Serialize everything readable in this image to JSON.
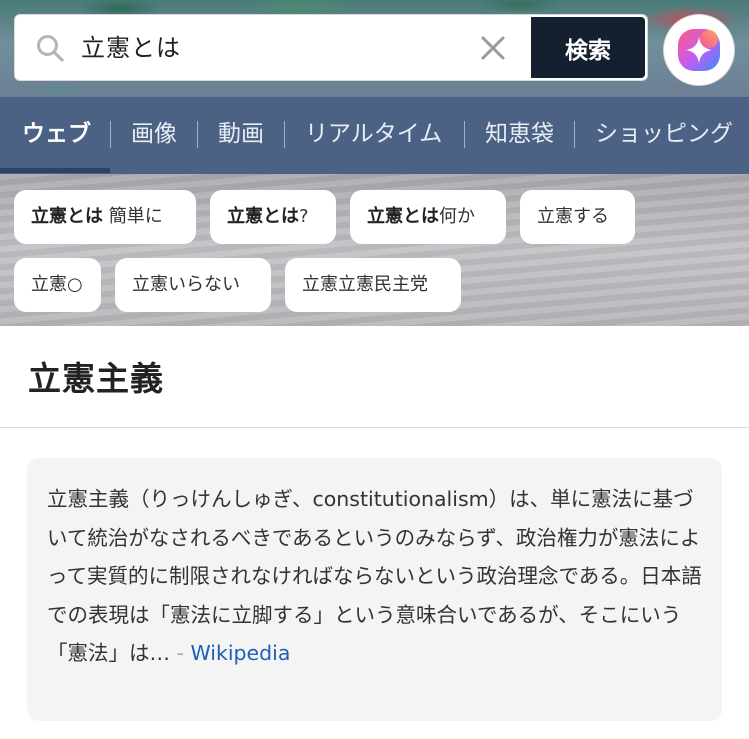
{
  "search": {
    "query": "立憲とは",
    "button_label": "検索"
  },
  "tabs": [
    {
      "label": "ウェブ"
    },
    {
      "label": "画像"
    },
    {
      "label": "動画"
    },
    {
      "label": "リアルタイム"
    },
    {
      "label": "知恵袋"
    },
    {
      "label": "ショッピング"
    }
  ],
  "suggestions": [
    {
      "bold": "立憲とは",
      "rest": " 簡単に"
    },
    {
      "bold": "立憲とは",
      "rest": "?"
    },
    {
      "bold": "立憲とは",
      "rest": "何か"
    },
    {
      "bold": "",
      "rest": "立憲する"
    },
    {
      "bold": "",
      "rest": "立憲○"
    },
    {
      "bold": "",
      "rest": "立憲いらない"
    },
    {
      "bold": "",
      "rest": "立憲立憲民主党"
    }
  ],
  "result": {
    "title": "立憲主義",
    "snippet": "立憲主義（りっけんしゅぎ、constitutionalism）は、単に憲法に基づいて統治がなされるべきであるというのみならず、政治権力が憲法によって実質的に制限されなければならないという政治理念である。日本語での表現は「憲法に立脚する」という意味合いであるが、そこにいう「憲法」は…",
    "dash": " - ",
    "source_label": "Wikipedia"
  },
  "colors": {
    "tabbar": "#4c6284",
    "search_button": "#142030",
    "link": "#1f5fb7"
  }
}
